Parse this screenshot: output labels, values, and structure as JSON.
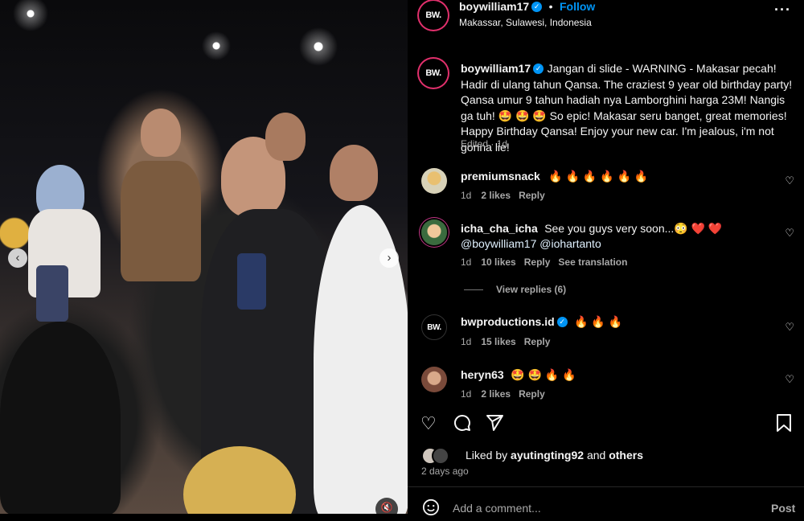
{
  "post": {
    "username": "boywilliam17",
    "follow_label": "Follow",
    "location": "Makassar, Sulawesi, Indonesia",
    "avatar_text": "BW.",
    "caption": "Jangan di slide - WARNING - Makasar pecah! Hadir di ulang tahun Qansa. The craziest 9 year old birthday party! Qansa umur 9 tahun hadiah nya Lamborghini harga 23M! Nangis ga tuh! 🤩 🤩 🤩 So epic! Makasar seru banget, great memories! Happy Birthday Qansa! Enjoy your new car. I'm jealous, i'm not gonna lie!",
    "caption_meta": "Edited · 1d",
    "more_icon": "more-horizontal-icon"
  },
  "comments": [
    {
      "user": "premiumsnack",
      "text": "🔥 🔥 🔥 🔥 🔥 🔥",
      "time": "1d",
      "likes": "2 likes",
      "reply": "Reply",
      "verified": false
    },
    {
      "user": "icha_cha_icha",
      "text": "See you guys very soon...😳 ❤️ ❤️",
      "mentions": "@boywilliam17 @iohartanto",
      "time": "1d",
      "likes": "10 likes",
      "reply": "Reply",
      "translate": "See translation",
      "view_replies": "View replies (6)",
      "verified": false
    },
    {
      "user": "bwproductions.id",
      "text": "🔥 🔥 🔥",
      "time": "1d",
      "likes": "15 likes",
      "reply": "Reply",
      "verified": true,
      "avatar_text": "BW."
    },
    {
      "user": "heryn63",
      "text": "🤩 🤩 🔥 🔥",
      "time": "1d",
      "likes": "2 likes",
      "reply": "Reply",
      "verified": false
    }
  ],
  "footer": {
    "liked_by_prefix": "Liked by",
    "liked_by_user": "ayutingting92",
    "liked_by_and": "and",
    "liked_by_others": "others",
    "date": "2 days ago",
    "comment_placeholder": "Add a comment...",
    "post_label": "Post"
  },
  "colors": {
    "accent": "#0095f6",
    "bg": "#000000",
    "muted": "#a8a8a8"
  }
}
